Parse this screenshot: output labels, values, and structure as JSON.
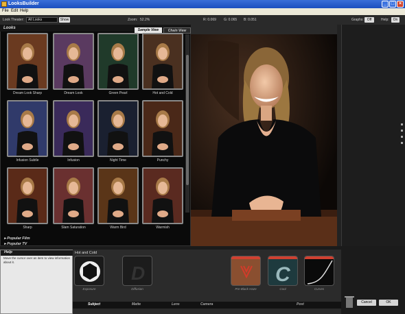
{
  "window": {
    "title": "LooksBuilder",
    "min": "_",
    "max": "□",
    "close": "×"
  },
  "menu": [
    "File",
    "Edit",
    "Help"
  ],
  "toolbar": {
    "look_theater_label": "Look Theater:",
    "look_theater_value": "All Looks",
    "show_button": "Show",
    "zoom_label": "Zoom:",
    "zoom_value": "52.2%",
    "r": "R: 0.069",
    "g": "G: 0.065",
    "b": "B: 0.051",
    "graphs_label": "Graphs:",
    "graphs_value": "Off",
    "help_label": "Help:",
    "help_value": "On"
  },
  "looks": {
    "header": "Looks",
    "tabs": [
      "Sample View",
      "Chain View"
    ],
    "thumbs": [
      {
        "label": "Dream Look Sharp"
      },
      {
        "label": "Dream Look"
      },
      {
        "label": "Green Pearl"
      },
      {
        "label": "Hot and Cold"
      },
      {
        "label": "Infusion Subtle"
      },
      {
        "label": "Infusion"
      },
      {
        "label": "Night Time"
      },
      {
        "label": "Punchy"
      },
      {
        "label": "Sharp"
      },
      {
        "label": "Slam Saturation"
      },
      {
        "label": "Warm Bird"
      },
      {
        "label": "Warmish"
      }
    ],
    "categories": [
      "Popular Film",
      "Popular TV"
    ]
  },
  "help": {
    "title": "Help",
    "text": "Move the cursor over an item to view information about it."
  },
  "pipeline": {
    "look_name": "Hot and Cold",
    "tools": [
      {
        "label": "Exposure",
        "icon": "aperture-icon"
      },
      {
        "label": "Diffusion",
        "icon": "diffusion-d-icon"
      },
      {
        "label": "Pre-Black Haze",
        "icon": "haze-icon"
      },
      {
        "label": "Cool",
        "icon": "cool-c-icon"
      },
      {
        "label": "Curves",
        "icon": "curves-icon"
      }
    ],
    "stages": [
      "Subject",
      "Matte",
      "Lens",
      "Camera",
      "Post"
    ]
  },
  "buttons": {
    "cancel": "Cancel",
    "ok": "OK"
  },
  "colors": {
    "accent_red": "#c0392b",
    "panel_bg": "#0a0a0a",
    "titlebar": "#2a5fcf"
  }
}
